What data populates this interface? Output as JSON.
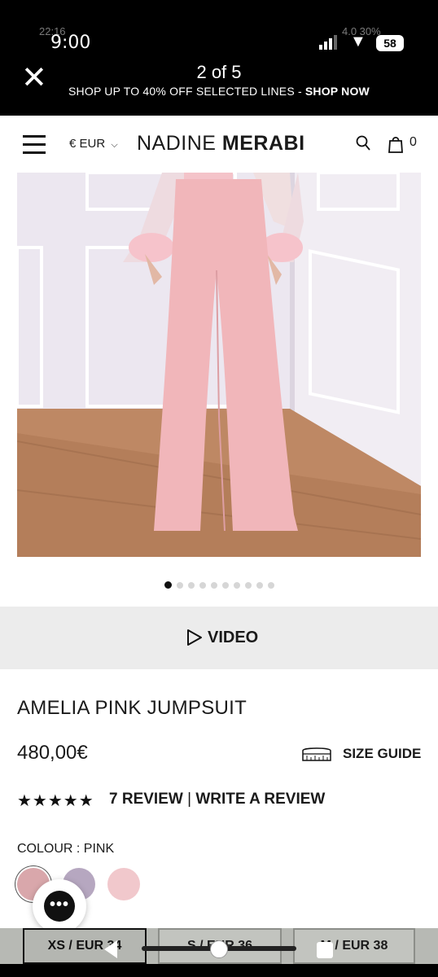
{
  "status_bar": {
    "time": "9:00",
    "ghost_time": "22:16",
    "ghost_battery": "4.0 30%",
    "battery": "58"
  },
  "top_bar": {
    "counter": "2 of 5",
    "promo_text": "SHOP UP TO 40% OFF SELECTED LINES -",
    "promo_link": "SHOP NOW"
  },
  "header": {
    "currency": "€ EUR",
    "brand_light": "NADINE",
    "brand_bold": "MERABI",
    "cart_count": "0"
  },
  "gallery": {
    "slide_count": 10,
    "active_index": 0
  },
  "video_label": "VIDEO",
  "product": {
    "title": "AMELIA PINK JUMPSUIT",
    "price": "480,00€",
    "size_guide": "SIZE GUIDE",
    "rating_stars": "★★★★★",
    "rating": 4.5,
    "review_count_label": "7 REVIEW",
    "separator": "|",
    "write_review": "WRITE A REVIEW",
    "colour_label": "COLOUR : PINK"
  },
  "swatches": [
    {
      "name": "pink",
      "color": "#d9a7ab"
    },
    {
      "name": "lilac",
      "color": "#b6a7c0"
    },
    {
      "name": "blush",
      "color": "#f1c8cc"
    }
  ],
  "chat_icon": "•••",
  "sizes": [
    {
      "label": "XS / EUR 34",
      "selected": true
    },
    {
      "label": "S / EUR 36",
      "selected": false
    },
    {
      "label": "M / EUR 38",
      "selected": false
    }
  ]
}
